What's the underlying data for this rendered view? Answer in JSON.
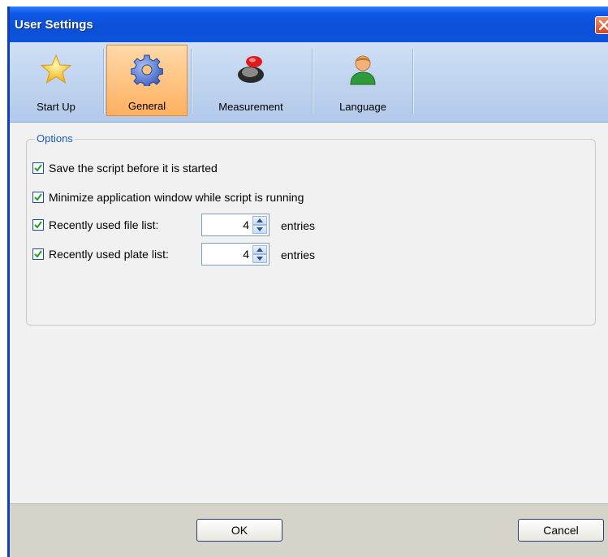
{
  "window": {
    "title": "User Settings"
  },
  "toolbar": {
    "items": [
      {
        "label": "Start Up",
        "icon": "star-icon"
      },
      {
        "label": "General",
        "icon": "gear-icon",
        "selected": true
      },
      {
        "label": "Measurement",
        "icon": "measurement-icon"
      },
      {
        "label": "Language",
        "icon": "person-icon"
      }
    ]
  },
  "options": {
    "legend": "Options",
    "save_script": {
      "label": "Save the script before it is started",
      "checked": true
    },
    "minimize_window": {
      "label": "Minimize application window while script is running",
      "checked": true
    },
    "recent_files": {
      "label": "Recently used file list:",
      "checked": true,
      "value": "4",
      "unit": "entries"
    },
    "recent_plates": {
      "label": "Recently used plate list:",
      "checked": true,
      "value": "4",
      "unit": "entries"
    }
  },
  "buttons": {
    "ok": "OK",
    "cancel": "Cancel"
  },
  "colors": {
    "title_bar": "#0b4fd6",
    "selected_tab": "#ffb060",
    "legend_text": "#1a5ec7"
  }
}
